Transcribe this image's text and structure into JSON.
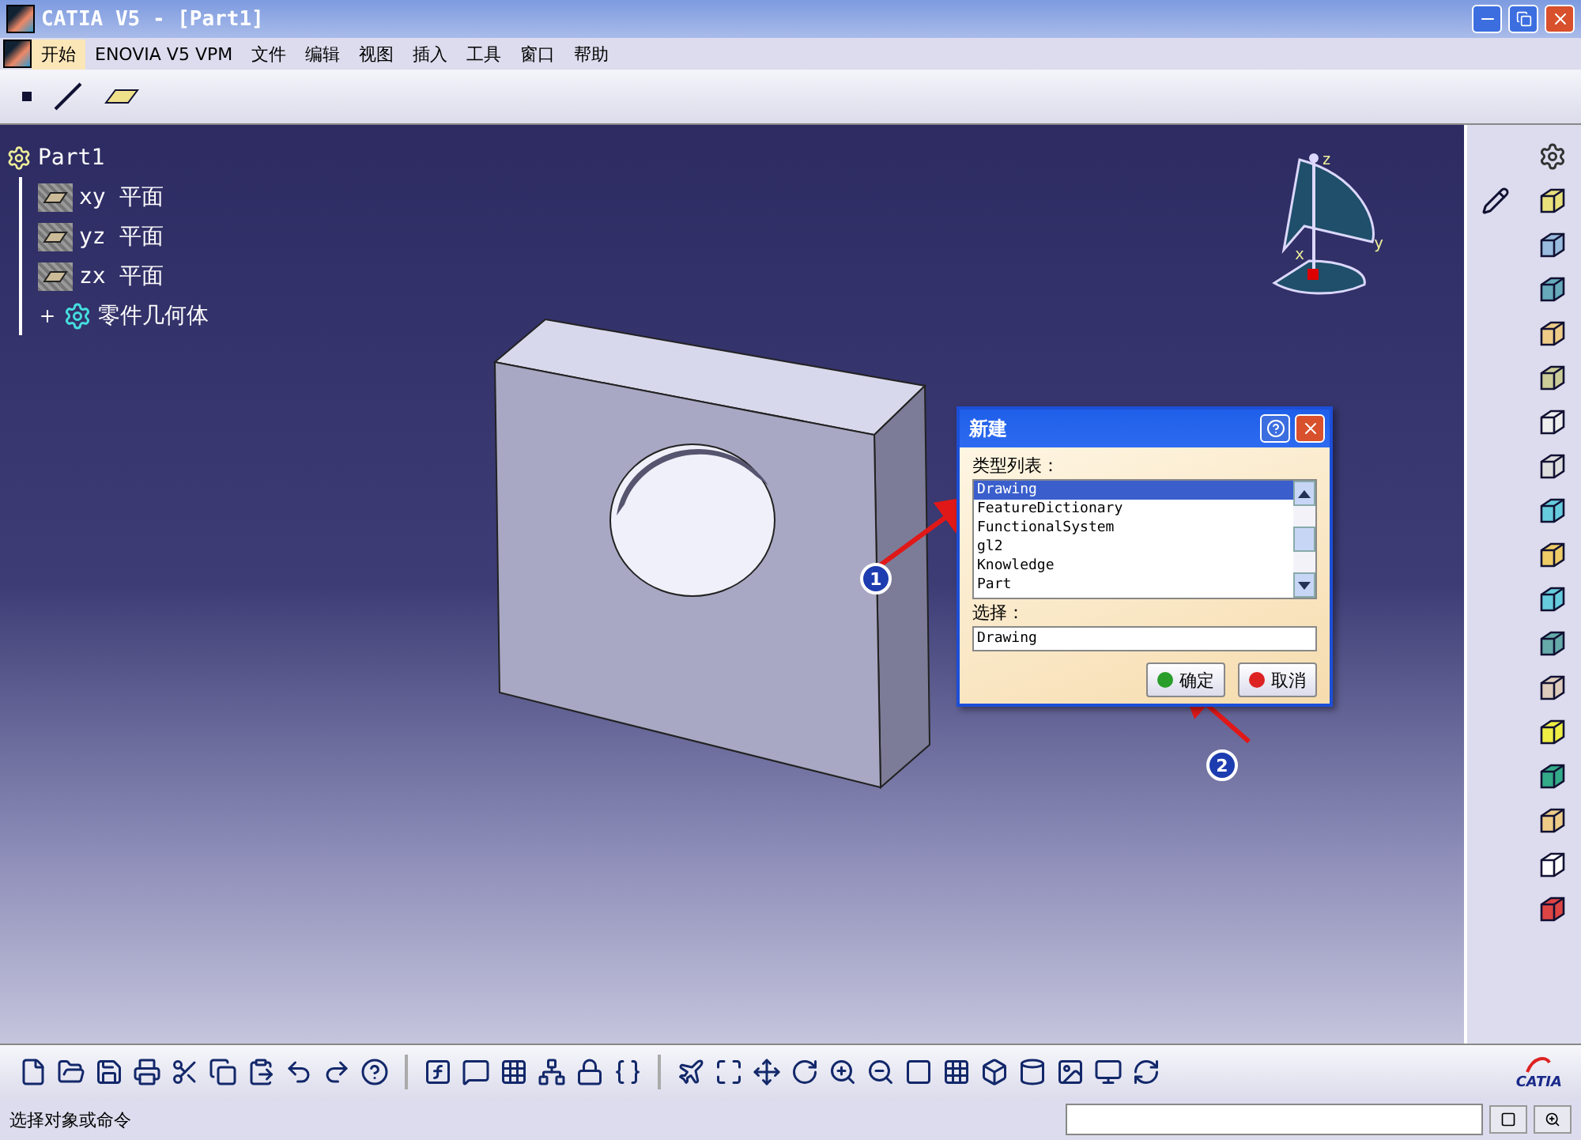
{
  "window": {
    "title": "CATIA V5 - [Part1]"
  },
  "menu": [
    {
      "label": "开始",
      "selected": true
    },
    {
      "label": "ENOVIA V5 VPM",
      "selected": false
    },
    {
      "label": "文件",
      "selected": false
    },
    {
      "label": "编辑",
      "selected": false
    },
    {
      "label": "视图",
      "selected": false
    },
    {
      "label": "插入",
      "selected": false
    },
    {
      "label": "工具",
      "selected": false
    },
    {
      "label": "窗口",
      "selected": false
    },
    {
      "label": "帮助",
      "selected": false
    }
  ],
  "tree": {
    "label": "Part1",
    "children": [
      {
        "label": "xy 平面",
        "kind": "plane"
      },
      {
        "label": "yz 平面",
        "kind": "plane"
      },
      {
        "label": "zx 平面",
        "kind": "plane"
      },
      {
        "label": "零件几何体",
        "kind": "body",
        "expanded": false
      }
    ]
  },
  "compass": {
    "axes": [
      "z",
      "y",
      "x"
    ]
  },
  "dialog": {
    "title": "新建",
    "list_label": "类型列表：",
    "items": [
      {
        "label": "Drawing",
        "selected": true
      },
      {
        "label": "FeatureDictionary",
        "selected": false
      },
      {
        "label": "FunctionalSystem",
        "selected": false
      },
      {
        "label": "gl2",
        "selected": false
      },
      {
        "label": "Knowledge",
        "selected": false
      },
      {
        "label": "Part",
        "selected": false
      }
    ],
    "choice_label": "选择：",
    "choice_value": "Drawing",
    "buttons": [
      {
        "label": "确定",
        "kind": "ok"
      },
      {
        "label": "取消",
        "kind": "cancel"
      }
    ]
  },
  "annotations": [
    {
      "label": "1"
    },
    {
      "label": "2"
    }
  ],
  "logo": {
    "text": "CATIA"
  },
  "status_bar": {
    "message": "选择对象或命令"
  }
}
